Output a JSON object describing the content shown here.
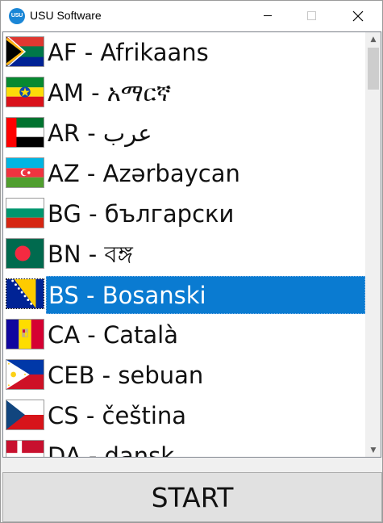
{
  "window": {
    "title": "USU Software",
    "icon_text": "USU",
    "icons": {
      "app": "usu-logo-icon",
      "minimize": "minimize-icon",
      "maximize": "maximize-icon",
      "close": "close-icon"
    }
  },
  "languages": [
    {
      "label": "AF - Afrikaans",
      "flag": "za"
    },
    {
      "label": "AM - አማርኛ",
      "flag": "et"
    },
    {
      "label": "AR - عرب",
      "flag": "ae"
    },
    {
      "label": "AZ - Azərbaycan",
      "flag": "az"
    },
    {
      "label": "BG - български",
      "flag": "bg"
    },
    {
      "label": "BN - বঙ্গ",
      "flag": "bd"
    },
    {
      "label": "BS - Bosanski",
      "flag": "ba",
      "selected": true
    },
    {
      "label": "CA - Català",
      "flag": "ad"
    },
    {
      "label": "CEB - sebuan",
      "flag": "ph"
    },
    {
      "label": "CS - čeština",
      "flag": "cz"
    },
    {
      "label": "DA - dansk",
      "flag": "dk"
    }
  ],
  "scrollbar": {
    "up_icon": "scroll-up-icon",
    "down_icon": "scroll-down-icon"
  },
  "start_button": {
    "label": "START"
  },
  "colors": {
    "selection": "#0a7bd1",
    "button": "#e1e1e1"
  }
}
